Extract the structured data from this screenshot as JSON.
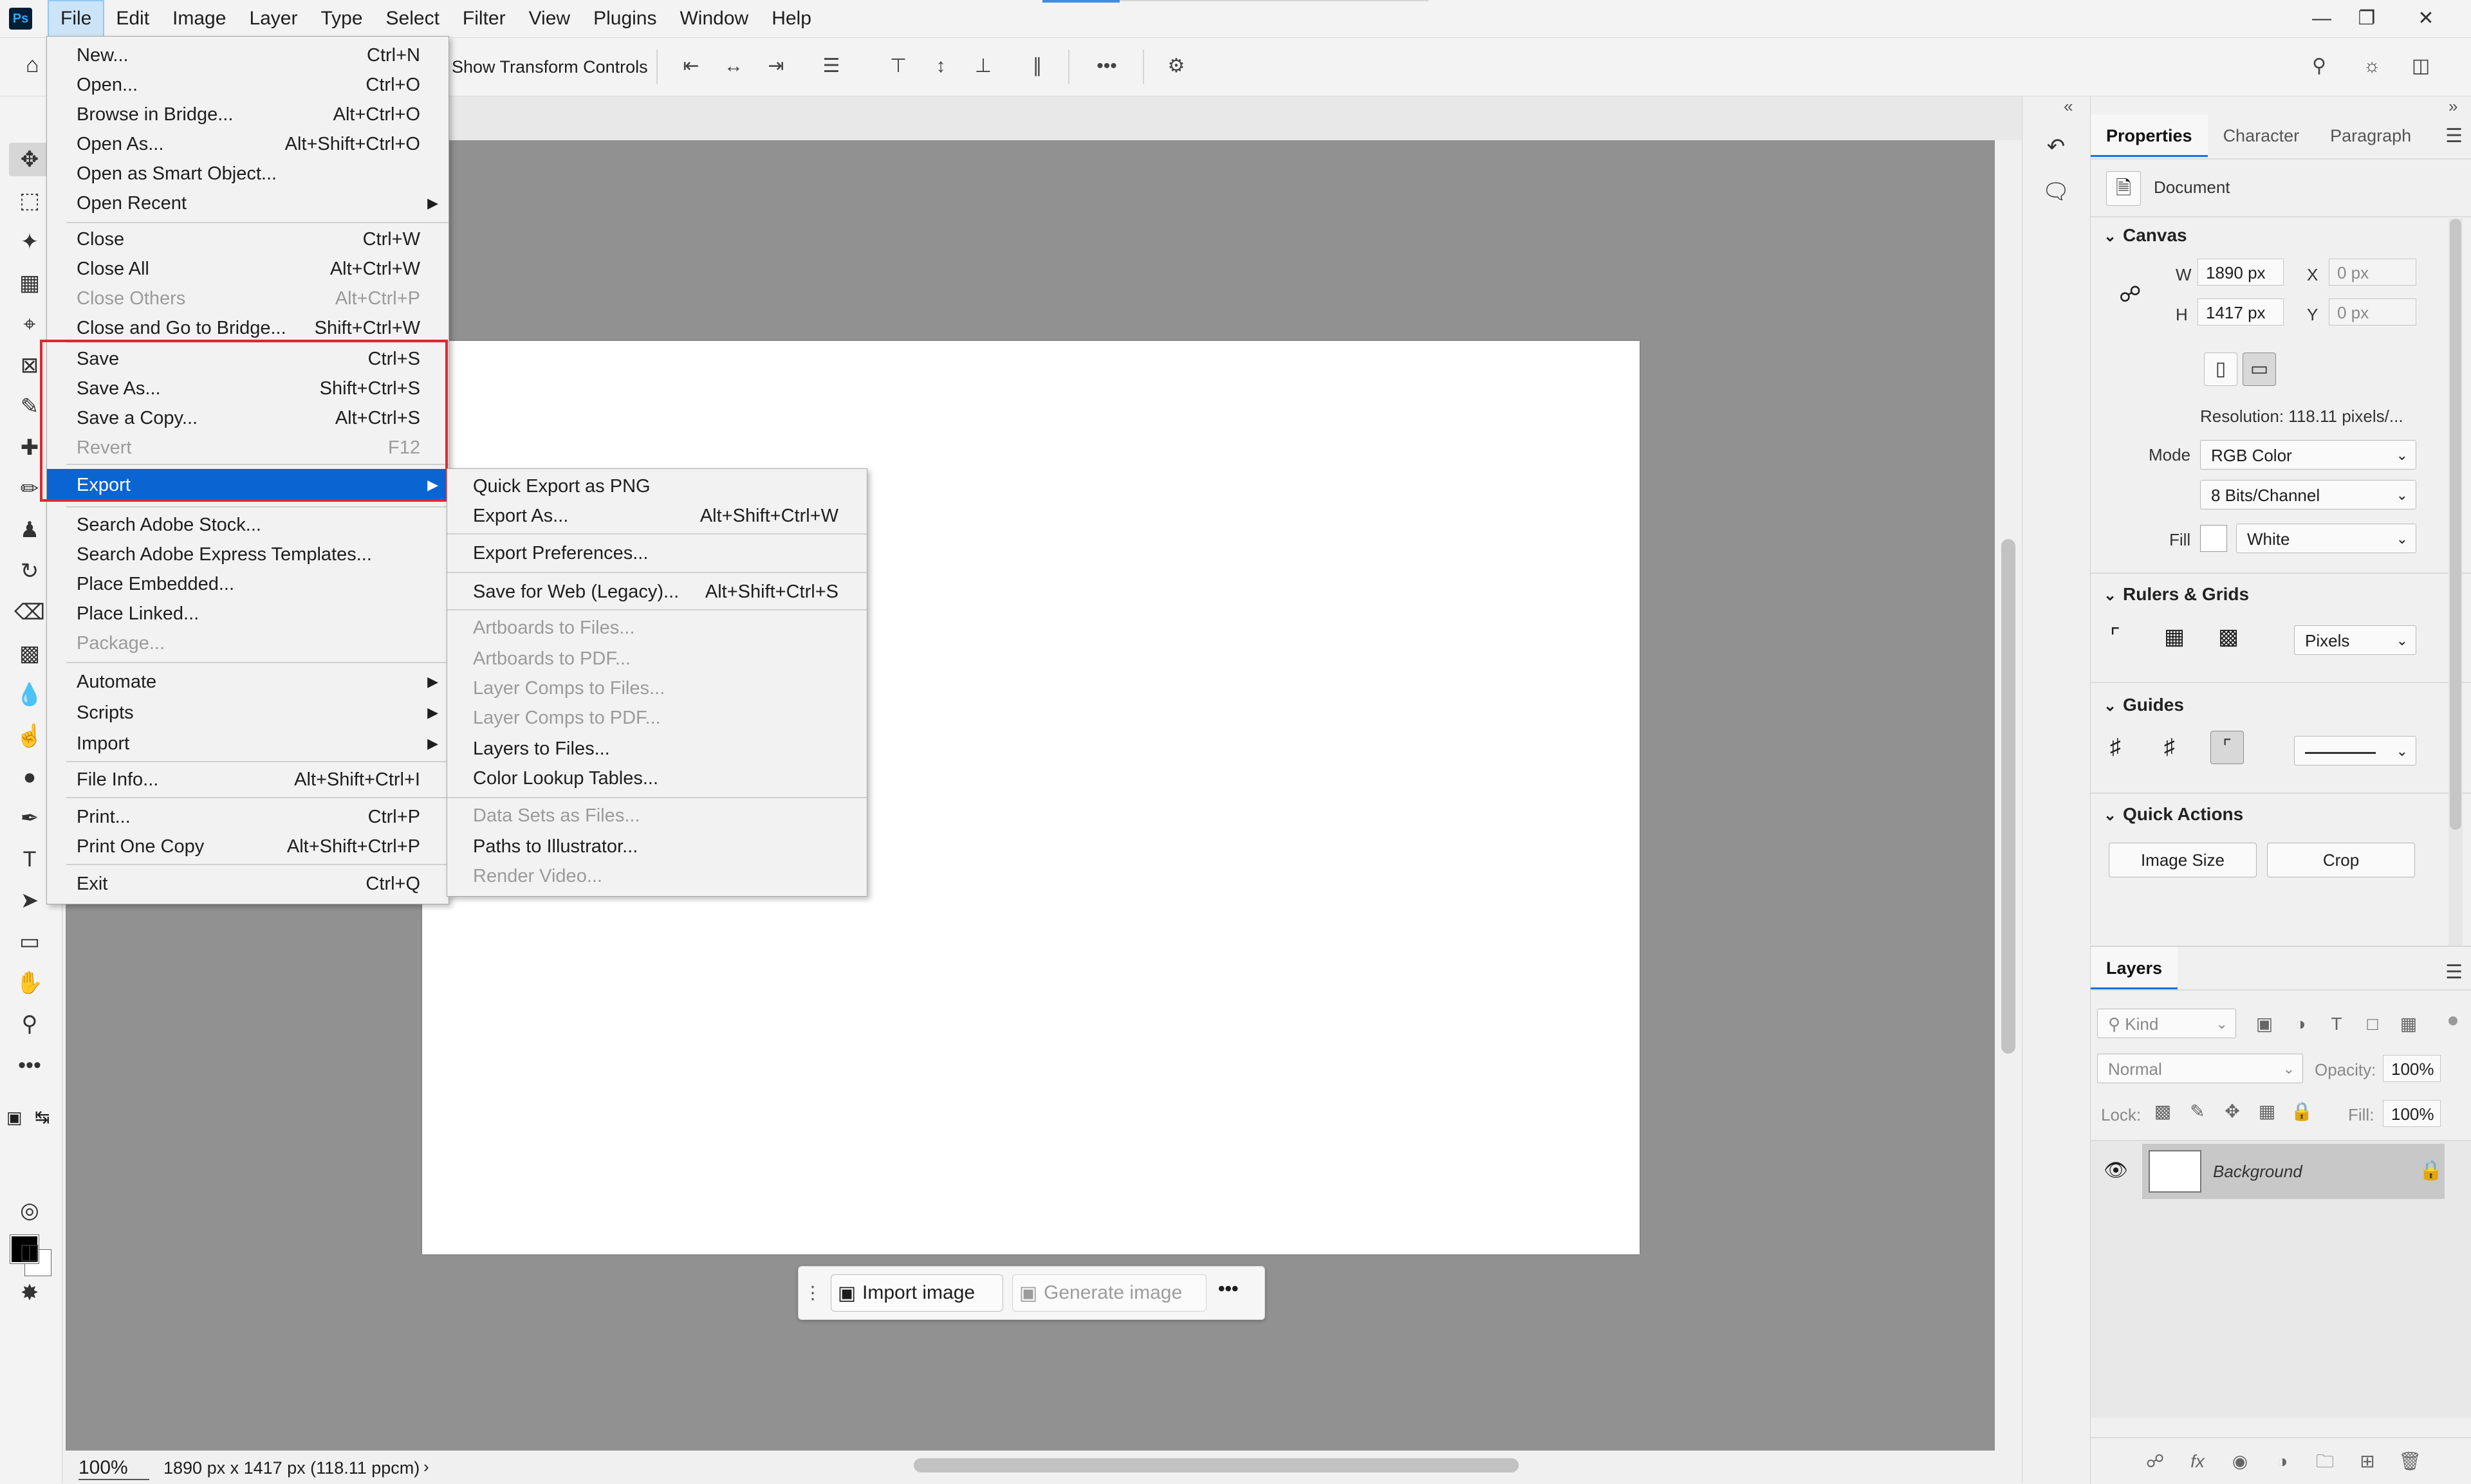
{
  "menubar": {
    "logo": "Ps",
    "items": [
      "File",
      "Edit",
      "Image",
      "Layer",
      "Type",
      "Select",
      "Filter",
      "View",
      "Plugins",
      "Window",
      "Help"
    ]
  },
  "options_bar": {
    "transform_label": "Show Transform Controls"
  },
  "file_menu": {
    "items": [
      {
        "label": "New...",
        "shortcut": "Ctrl+N"
      },
      {
        "label": "Open...",
        "shortcut": "Ctrl+O"
      },
      {
        "label": "Browse in Bridge...",
        "shortcut": "Alt+Ctrl+O"
      },
      {
        "label": "Open As...",
        "shortcut": "Alt+Shift+Ctrl+O"
      },
      {
        "label": "Open as Smart Object...",
        "shortcut": ""
      },
      {
        "label": "Open Recent",
        "shortcut": ""
      },
      {
        "label": "Close",
        "shortcut": "Ctrl+W"
      },
      {
        "label": "Close All",
        "shortcut": "Alt+Ctrl+W"
      },
      {
        "label": "Close Others",
        "shortcut": "Alt+Ctrl+P"
      },
      {
        "label": "Close and Go to Bridge...",
        "shortcut": "Shift+Ctrl+W"
      },
      {
        "label": "Save",
        "shortcut": "Ctrl+S"
      },
      {
        "label": "Save As...",
        "shortcut": "Shift+Ctrl+S"
      },
      {
        "label": "Save a Copy...",
        "shortcut": "Alt+Ctrl+S"
      },
      {
        "label": "Revert",
        "shortcut": "F12"
      },
      {
        "label": "Export",
        "shortcut": ""
      },
      {
        "label": "Search Adobe Stock...",
        "shortcut": ""
      },
      {
        "label": "Search Adobe Express Templates...",
        "shortcut": ""
      },
      {
        "label": "Place Embedded...",
        "shortcut": ""
      },
      {
        "label": "Place Linked...",
        "shortcut": ""
      },
      {
        "label": "Package...",
        "shortcut": ""
      },
      {
        "label": "Automate",
        "shortcut": ""
      },
      {
        "label": "Scripts",
        "shortcut": ""
      },
      {
        "label": "Import",
        "shortcut": ""
      },
      {
        "label": "File Info...",
        "shortcut": "Alt+Shift+Ctrl+I"
      },
      {
        "label": "Print...",
        "shortcut": "Ctrl+P"
      },
      {
        "label": "Print One Copy",
        "shortcut": "Alt+Shift+Ctrl+P"
      },
      {
        "label": "Exit",
        "shortcut": "Ctrl+Q"
      }
    ]
  },
  "export_menu": {
    "items": [
      {
        "label": "Quick Export as PNG",
        "shortcut": ""
      },
      {
        "label": "Export As...",
        "shortcut": "Alt+Shift+Ctrl+W"
      },
      {
        "label": "Export Preferences...",
        "shortcut": ""
      },
      {
        "label": "Save for Web (Legacy)...",
        "shortcut": "Alt+Shift+Ctrl+S"
      },
      {
        "label": "Artboards to Files...",
        "shortcut": ""
      },
      {
        "label": "Artboards to PDF...",
        "shortcut": ""
      },
      {
        "label": "Layer Comps to Files...",
        "shortcut": ""
      },
      {
        "label": "Layer Comps to PDF...",
        "shortcut": ""
      },
      {
        "label": "Layers to Files...",
        "shortcut": ""
      },
      {
        "label": "Color Lookup Tables...",
        "shortcut": ""
      },
      {
        "label": "Data Sets as Files...",
        "shortcut": ""
      },
      {
        "label": "Paths to Illustrator...",
        "shortcut": ""
      },
      {
        "label": "Render Video...",
        "shortcut": ""
      }
    ]
  },
  "taskbar": {
    "import_label": "Import image",
    "generate_label": "Generate image"
  },
  "status": {
    "zoom": "100%",
    "doc_info": "1890 px x 1417 px (118.11 ppcm)"
  },
  "properties": {
    "tabs": [
      "Properties",
      "Character",
      "Paragraph"
    ],
    "doc_label": "Document",
    "canvas_title": "Canvas",
    "w_label": "W",
    "w_value": "1890 px",
    "h_label": "H",
    "h_value": "1417 px",
    "x_label": "X",
    "x_value": "0 px",
    "y_label": "Y",
    "y_value": "0 px",
    "resolution": "Resolution: 118.11 pixels/...",
    "mode_label": "Mode",
    "mode_value": "RGB Color",
    "bits_value": "8 Bits/Channel",
    "fill_label": "Fill",
    "fill_value": "White",
    "rulers_title": "Rulers & Grids",
    "units_value": "Pixels",
    "guides_title": "Guides",
    "quick_actions_title": "Quick Actions",
    "image_size_label": "Image Size",
    "crop_label": "Crop"
  },
  "layers": {
    "tab": "Layers",
    "kind_placeholder": "Kind",
    "blend_mode": "Normal",
    "opacity_label": "Opacity:",
    "opacity_value": "100%",
    "lock_label": "Lock:",
    "fill_label": "Fill:",
    "fill_value": "100%",
    "layer_name": "Background"
  },
  "colors": {
    "accent": "#0a64d2",
    "highlight_box": "#e3262e",
    "canvas_bg": "#919191"
  }
}
